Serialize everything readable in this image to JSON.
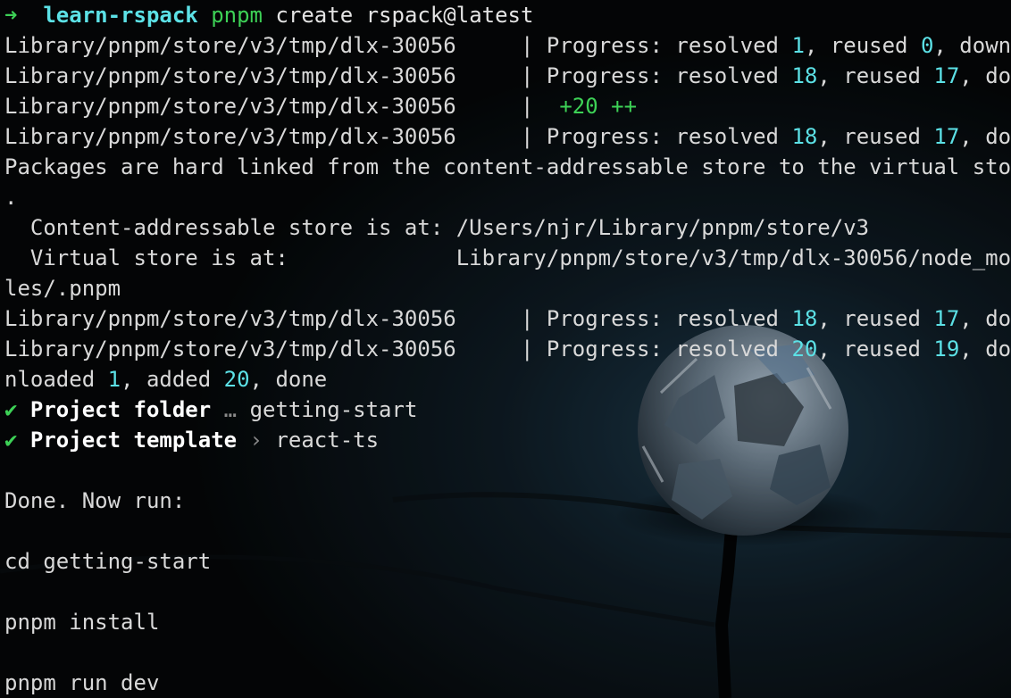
{
  "prompt": {
    "arrow": "➜",
    "directory": "learn-rspack",
    "command": "pnpm",
    "args": "create rspack@latest"
  },
  "colors": {
    "number": "#5ce1e6",
    "success": "#3dd156",
    "text": "#d9d9d9",
    "dim": "#8a8a8a"
  },
  "lines": [
    {
      "type": "progress",
      "path": "Library/pnpm/store/v3/tmp/dlx-30056",
      "sep": "     | ",
      "label": "Progress: resolved ",
      "resolved": "1",
      "mid": ", reused ",
      "reused": "0",
      "tail": ", downl"
    },
    {
      "type": "progress",
      "path": "Library/pnpm/store/v3/tmp/dlx-30056",
      "sep": "     | ",
      "label": "Progress: resolved ",
      "resolved": "18",
      "mid": ", reused ",
      "reused": "17",
      "tail": ", dow"
    },
    {
      "type": "added",
      "path": "Library/pnpm/store/v3/tmp/dlx-30056",
      "sep": "     |  ",
      "value": "+20 ++"
    },
    {
      "type": "progress",
      "path": "Library/pnpm/store/v3/tmp/dlx-30056",
      "sep": "     | ",
      "label": "Progress: resolved ",
      "resolved": "18",
      "mid": ", reused ",
      "reused": "17",
      "tail": ", dow"
    },
    {
      "type": "text",
      "text": "Packages are hard linked from the content-addressable store to the virtual store"
    },
    {
      "type": "text",
      "text": "."
    },
    {
      "type": "text",
      "text": "  Content-addressable store is at: /Users/njr/Library/pnpm/store/v3"
    },
    {
      "type": "text",
      "text": "  Virtual store is at:             Library/pnpm/store/v3/tmp/dlx-30056/node_modu"
    },
    {
      "type": "text",
      "text": "les/.pnpm"
    },
    {
      "type": "progress",
      "path": "Library/pnpm/store/v3/tmp/dlx-30056",
      "sep": "     | ",
      "label": "Progress: resolved ",
      "resolved": "18",
      "mid": ", reused ",
      "reused": "17",
      "tail": ", dow"
    },
    {
      "type": "progress",
      "path": "Library/pnpm/store/v3/tmp/dlx-30056",
      "sep": "     | ",
      "label": "Progress: resolved ",
      "resolved": "20",
      "mid": ", reused ",
      "reused": "19",
      "tail": ", dow"
    },
    {
      "type": "summary",
      "p1": "nloaded ",
      "downloaded": "1",
      "p2": ", added ",
      "added": "20",
      "p3": ", done"
    },
    {
      "type": "question",
      "check": "✔",
      "label": "Project folder",
      "sep": " … ",
      "answer": "getting-start"
    },
    {
      "type": "question",
      "check": "✔",
      "label": "Project template",
      "sep": " › ",
      "answer": "react-ts"
    },
    {
      "type": "text",
      "text": ""
    },
    {
      "type": "text",
      "text": "Done. Now run:"
    },
    {
      "type": "text",
      "text": ""
    },
    {
      "type": "text",
      "text": "cd getting-start"
    },
    {
      "type": "text",
      "text": ""
    },
    {
      "type": "text",
      "text": "pnpm install"
    },
    {
      "type": "text",
      "text": ""
    },
    {
      "type": "text",
      "text": "pnpm run dev"
    }
  ]
}
